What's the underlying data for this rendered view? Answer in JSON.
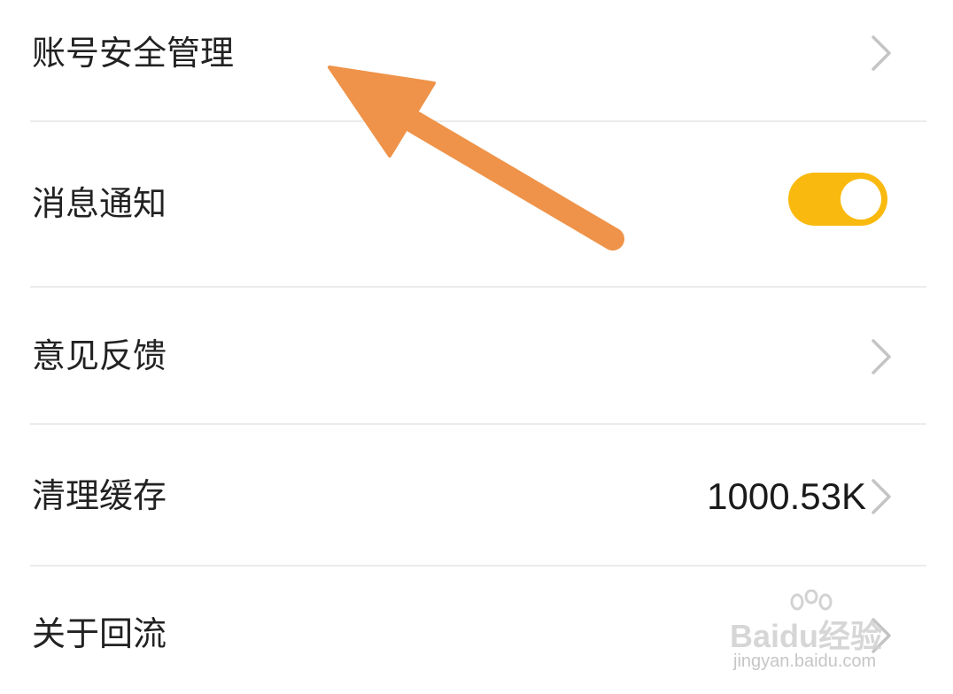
{
  "settings": {
    "items": [
      {
        "label": "账号安全管理"
      },
      {
        "label": "消息通知",
        "toggle_on": true
      },
      {
        "label": "意见反馈"
      },
      {
        "label": "清理缓存",
        "value": "1000.53K"
      },
      {
        "label": "关于回流"
      }
    ]
  },
  "icons": {
    "chevron": "chevron-right-icon",
    "annotation": "arrow-annotation"
  },
  "colors": {
    "toggle_on": "#f9b90e",
    "arrow": "#ee9349",
    "divider": "#ebebeb",
    "text": "#222222"
  },
  "watermark": {
    "brand": "Baidu经验",
    "url": "jingyan.baidu.com"
  }
}
